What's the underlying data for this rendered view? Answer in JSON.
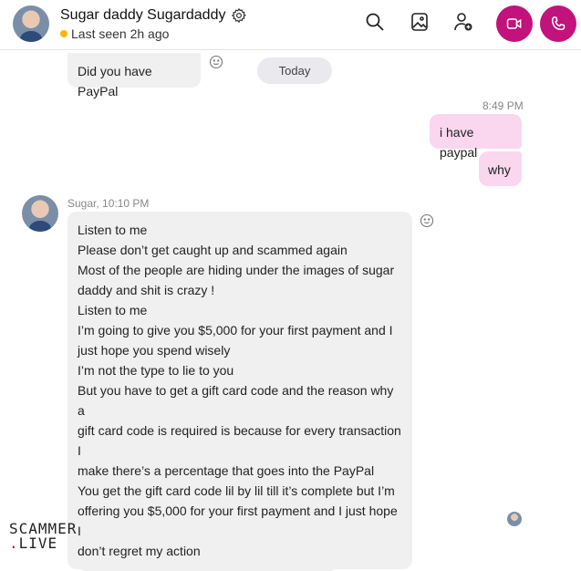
{
  "header": {
    "contact_name": "Sugar daddy Sugardaddy",
    "status": "Last seen 2h ago",
    "status_color": "#f8b700",
    "accent_color": "#c2127c",
    "icons": [
      "gear-icon",
      "search-icon",
      "gallery-icon",
      "add-person-icon",
      "video-call-icon",
      "audio-call-icon"
    ]
  },
  "messages": {
    "first": "Did you have PayPal",
    "date_divider": "Today",
    "out_time": "8:49 PM",
    "out_1": "i have paypal",
    "out_2": "why",
    "in_meta": "Sugar, 10:10 PM",
    "long_lines": [
      "Listen to me",
      "Please don’t get caught up and scammed again",
      "Most of the people are hiding under the images of sugar",
      "daddy and shit is crazy !",
      "Listen to me",
      "I’m going to give you $5,000  for your first payment and I",
      "just hope you spend wisely",
      "I’m not the type to lie to you",
      "But you have to get a gift card code and the reason why a",
      "gift card code is required is because for every transaction I",
      "make there’s a percentage that goes into the PayPal",
      "You get the gift card code lil by lil till it’s complete but I’m",
      "offering you $5,000 for your first payment and I just hope I",
      "don’t regret my action"
    ]
  },
  "watermark": {
    "line1": "SCAMMER",
    "line2_dot": ".",
    "line2": "LIVE"
  }
}
